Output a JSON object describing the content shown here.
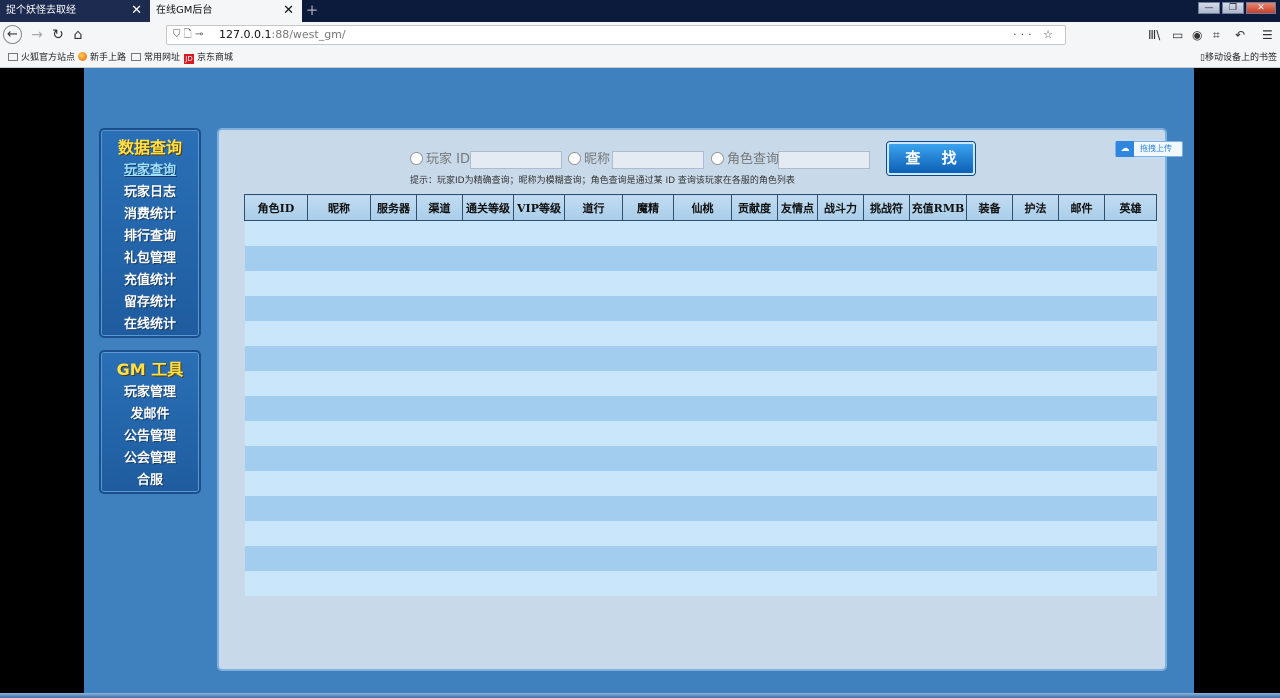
{
  "browser": {
    "tabs": [
      {
        "label": "捉个妖怪去取经",
        "close": "✕"
      },
      {
        "label": "在线GM后台",
        "close": "✕"
      }
    ],
    "new_tab": "+",
    "url": {
      "host": "127.0.0.1",
      "path": ":88/west_gm/"
    },
    "url_actions": "··· ☆",
    "bookmarks": [
      {
        "label": "火狐官方站点"
      },
      {
        "label": "新手上路"
      },
      {
        "label": "常用网址"
      },
      {
        "label": "京东商城"
      }
    ],
    "mobile_bookmarks": "移动设备上的书签"
  },
  "sidebar": {
    "data_menu": {
      "title": "数据查询",
      "items": [
        "玩家查询",
        "玩家日志",
        "消费统计",
        "排行查询",
        "礼包管理",
        "充值统计",
        "留存统计",
        "在线统计"
      ],
      "active_index": 0
    },
    "gm_menu": {
      "title": "GM 工具",
      "items": [
        "玩家管理",
        "发邮件",
        "公告管理",
        "公会管理",
        "合服"
      ]
    }
  },
  "search": {
    "player_id_label": "玩家 ID",
    "nickname_label": "昵称",
    "role_query_label": "角色查询",
    "player_id_value": "",
    "nickname_value": "",
    "role_query_value": "",
    "button_label": "查 找",
    "hint": "提示：玩家ID为精确查询；昵称为模糊查询；角色查询是通过某 ID 查询该玩家在各服的角色列表"
  },
  "upload_widget": {
    "label": "拖拽上传"
  },
  "table": {
    "columns": [
      "角色ID",
      "昵称",
      "服务器",
      "渠道",
      "通关等级",
      "VIP等级",
      "道行",
      "魔精",
      "仙桃",
      "贡献度",
      "友情点",
      "战斗力",
      "挑战符",
      "充值RMB",
      "装备",
      "护法",
      "邮件",
      "英雄"
    ],
    "rows": []
  },
  "colors": {
    "page_bg": "#3f81be",
    "panel_bg": "#c8d9ea",
    "menu_title": "#ffe14a",
    "row_light": "#c9e6fb",
    "row_dark": "#a3cdee"
  }
}
